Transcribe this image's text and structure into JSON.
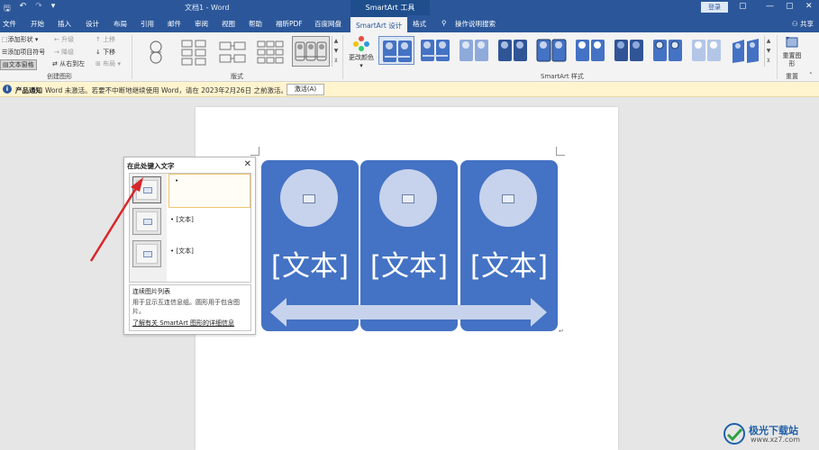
{
  "window": {
    "title": "文档1 - Word",
    "context_title": "SmartArt 工具",
    "login_label": "登录",
    "share_label": "共享"
  },
  "tabs": [
    {
      "label": "文件"
    },
    {
      "label": "开始"
    },
    {
      "label": "插入"
    },
    {
      "label": "设计"
    },
    {
      "label": "布局"
    },
    {
      "label": "引用"
    },
    {
      "label": "邮件"
    },
    {
      "label": "审阅"
    },
    {
      "label": "视图"
    },
    {
      "label": "帮助"
    },
    {
      "label": "福昕PDF"
    },
    {
      "label": "百度网盘"
    },
    {
      "label": "SmartArt 设计"
    },
    {
      "label": "格式"
    },
    {
      "label": "操作说明搜索"
    }
  ],
  "ribbon": {
    "create_graphic": {
      "add_shape": "添加形状",
      "add_bullet": "添加项目符号",
      "text_pane": "文本窗格",
      "promote": "升级",
      "demote": "降级",
      "right_to_left": "从右到左",
      "move_up": "上移",
      "move_down": "下移",
      "layout": "布局",
      "group_label": "创建图形"
    },
    "layouts": {
      "group_label": "版式"
    },
    "styles": {
      "change_colors": "更改颜色",
      "group_label": "SmartArt 样式"
    },
    "reset": {
      "reset_graphic": "重置图形",
      "group_label": "重置"
    }
  },
  "notification": {
    "label": "产品通知",
    "message": "Word 未激活。若要不中断地继续使用 Word，请在 2023年2月26日 之前激活。",
    "button": "激活(A)"
  },
  "smartart": {
    "panels": [
      {
        "text": "[文本]"
      },
      {
        "text": "[文本]"
      },
      {
        "text": "[文本]"
      }
    ]
  },
  "text_pane": {
    "title": "在此处键入文字",
    "items": [
      {
        "text": ""
      },
      {
        "text": "[文本]"
      },
      {
        "text": "[文本]"
      }
    ],
    "desc_title": "连续图片列表",
    "desc_body": "用于显示互连信息组。圆形用于包含图片。",
    "link": "了解有关 SmartArt 图形的详细信息"
  },
  "watermark": {
    "name": "极光下载站",
    "url": "www.xz7.com"
  },
  "colors": {
    "word_blue": "#2b579a",
    "smartart_fill": "#4472c4",
    "notification_bg": "#fff4ce"
  }
}
